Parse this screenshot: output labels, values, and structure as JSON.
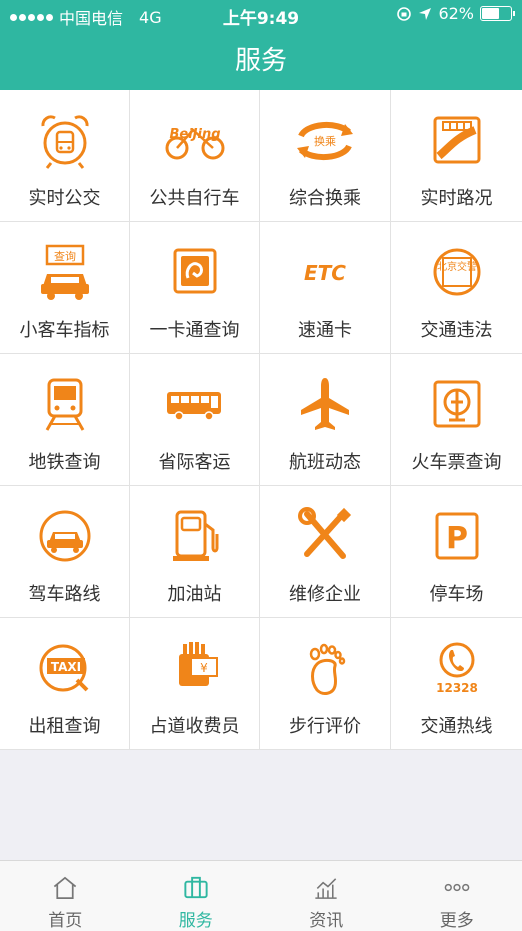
{
  "status_bar": {
    "carrier": "中国电信",
    "network": "4G",
    "time": "上午9:49",
    "battery_text": "62%",
    "battery_level": 0.62
  },
  "header": {
    "title": "服务"
  },
  "colors": {
    "accent": "#2fb7a1",
    "icon": "#f08519",
    "text": "#333333"
  },
  "grid": [
    {
      "label": "实时公交",
      "icon": "alarm-bus-icon"
    },
    {
      "label": "公共自行车",
      "icon": "beijing-bike-icon",
      "icon_text": "BeiJing"
    },
    {
      "label": "综合换乘",
      "icon": "transfer-arrows-icon",
      "icon_text": "换乘"
    },
    {
      "label": "实时路况",
      "icon": "road-condition-icon"
    },
    {
      "label": "小客车指标",
      "icon": "car-quota-icon",
      "icon_text": "查询"
    },
    {
      "label": "一卡通查询",
      "icon": "card-icon"
    },
    {
      "label": "速通卡",
      "icon": "etc-icon",
      "icon_text": "ETC"
    },
    {
      "label": "交通违法",
      "icon": "traffic-police-seal-icon",
      "icon_text": "北京交警"
    },
    {
      "label": "地铁查询",
      "icon": "subway-icon"
    },
    {
      "label": "省际客运",
      "icon": "coach-bus-icon"
    },
    {
      "label": "航班动态",
      "icon": "airplane-icon"
    },
    {
      "label": "火车票查询",
      "icon": "railway-logo-icon"
    },
    {
      "label": "驾车路线",
      "icon": "car-route-icon"
    },
    {
      "label": "加油站",
      "icon": "gas-pump-icon"
    },
    {
      "label": "维修企业",
      "icon": "wrench-screwdriver-icon"
    },
    {
      "label": "停车场",
      "icon": "parking-icon",
      "icon_text": "P"
    },
    {
      "label": "出租查询",
      "icon": "taxi-icon",
      "icon_text": "TAXI"
    },
    {
      "label": "占道收费员",
      "icon": "toll-collector-icon",
      "icon_text": "¥"
    },
    {
      "label": "步行评价",
      "icon": "footprint-icon"
    },
    {
      "label": "交通热线",
      "icon": "hotline-icon",
      "icon_text": "12328"
    }
  ],
  "tabbar": [
    {
      "label": "首页",
      "icon": "home-icon",
      "active": false
    },
    {
      "label": "服务",
      "icon": "briefcase-icon",
      "active": true
    },
    {
      "label": "资讯",
      "icon": "chart-icon",
      "active": false
    },
    {
      "label": "更多",
      "icon": "more-dots-icon",
      "active": false
    }
  ]
}
